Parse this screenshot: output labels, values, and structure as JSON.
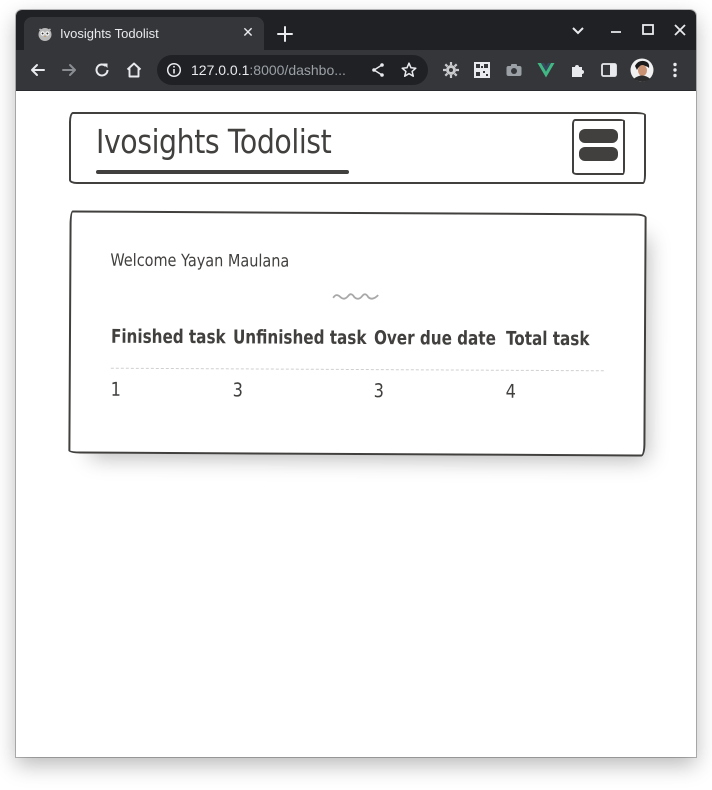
{
  "browser": {
    "tab": {
      "title": "Ivosights Todolist",
      "favicon": "owl-icon",
      "close_glyph": "✕"
    },
    "new_tab_icon": "plus-icon",
    "address_bar": {
      "host": "127.0.0.1",
      "rest": ":8000/dashbo..."
    },
    "colors": {
      "frame": "#202124",
      "toolbar": "#35363a",
      "omnibox": "#202124",
      "vue_accent": "#41b883"
    }
  },
  "app": {
    "brand": "Ivosights Todolist",
    "welcome": "Welcome Yayan Maulana",
    "divider": "~~~",
    "stats": {
      "headers": [
        "Finished task",
        "Unfinished task",
        "Over due date",
        "Total task"
      ],
      "values": [
        "1",
        "3",
        "3",
        "4"
      ]
    },
    "ink_color": "#41403e"
  }
}
